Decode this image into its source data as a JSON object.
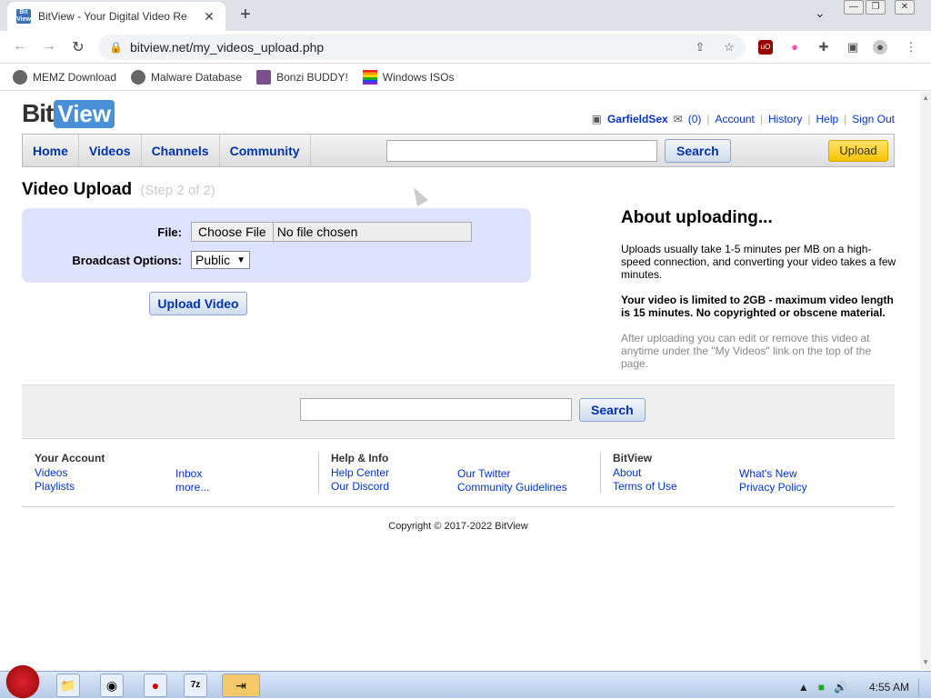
{
  "browser": {
    "tab_title": "BitView - Your Digital Video Re",
    "tab_favicon": "Bit View",
    "url": "bitview.net/my_videos_upload.php",
    "bookmarks": [
      "MEMZ Download",
      "Malware Database",
      "Bonzi BUDDY!",
      "Windows ISOs"
    ]
  },
  "site": {
    "logo_bit": "Bit",
    "logo_view": "View",
    "user": "GarfieldSex",
    "inbox_count": "(0)",
    "links": [
      "Account",
      "History",
      "Help",
      "Sign Out"
    ],
    "nav": [
      "Home",
      "Videos",
      "Channels",
      "Community"
    ],
    "search_label": "Search",
    "upload_label": "Upload"
  },
  "main": {
    "title": "Video Upload",
    "step": "(Step 2 of 2)",
    "file_label": "File:",
    "choose_file": "Choose File",
    "no_file": "No file chosen",
    "broadcast_label": "Broadcast Options:",
    "broadcast_value": "Public",
    "upload_video_button": "Upload Video"
  },
  "about": {
    "heading": "About uploading...",
    "p1": "Uploads usually take 1-5 minutes per MB on a high-speed connection, and converting your video takes a few minutes.",
    "p2": "Your video is limited to 2GB - maximum video length is 15 minutes. No copyrighted or obscene material.",
    "p3": "After uploading you can edit or remove this video at anytime under the \"My Videos\" link on the top of the page."
  },
  "footer": {
    "search_label": "Search",
    "account_heading": "Your Account",
    "account_links": [
      "Videos",
      "Playlists",
      "Inbox",
      "more..."
    ],
    "help_heading": "Help & Info",
    "help_links": [
      "Help Center",
      "Our Discord",
      "Our Twitter",
      "Community Guidelines"
    ],
    "bitview_heading": "BitView",
    "bitview_links": [
      "About",
      "Terms of Use",
      "What's New",
      "Privacy Policy"
    ],
    "copyright": "Copyright © 2017-2022 BitView"
  },
  "taskbar": {
    "time": "4:55 AM"
  }
}
